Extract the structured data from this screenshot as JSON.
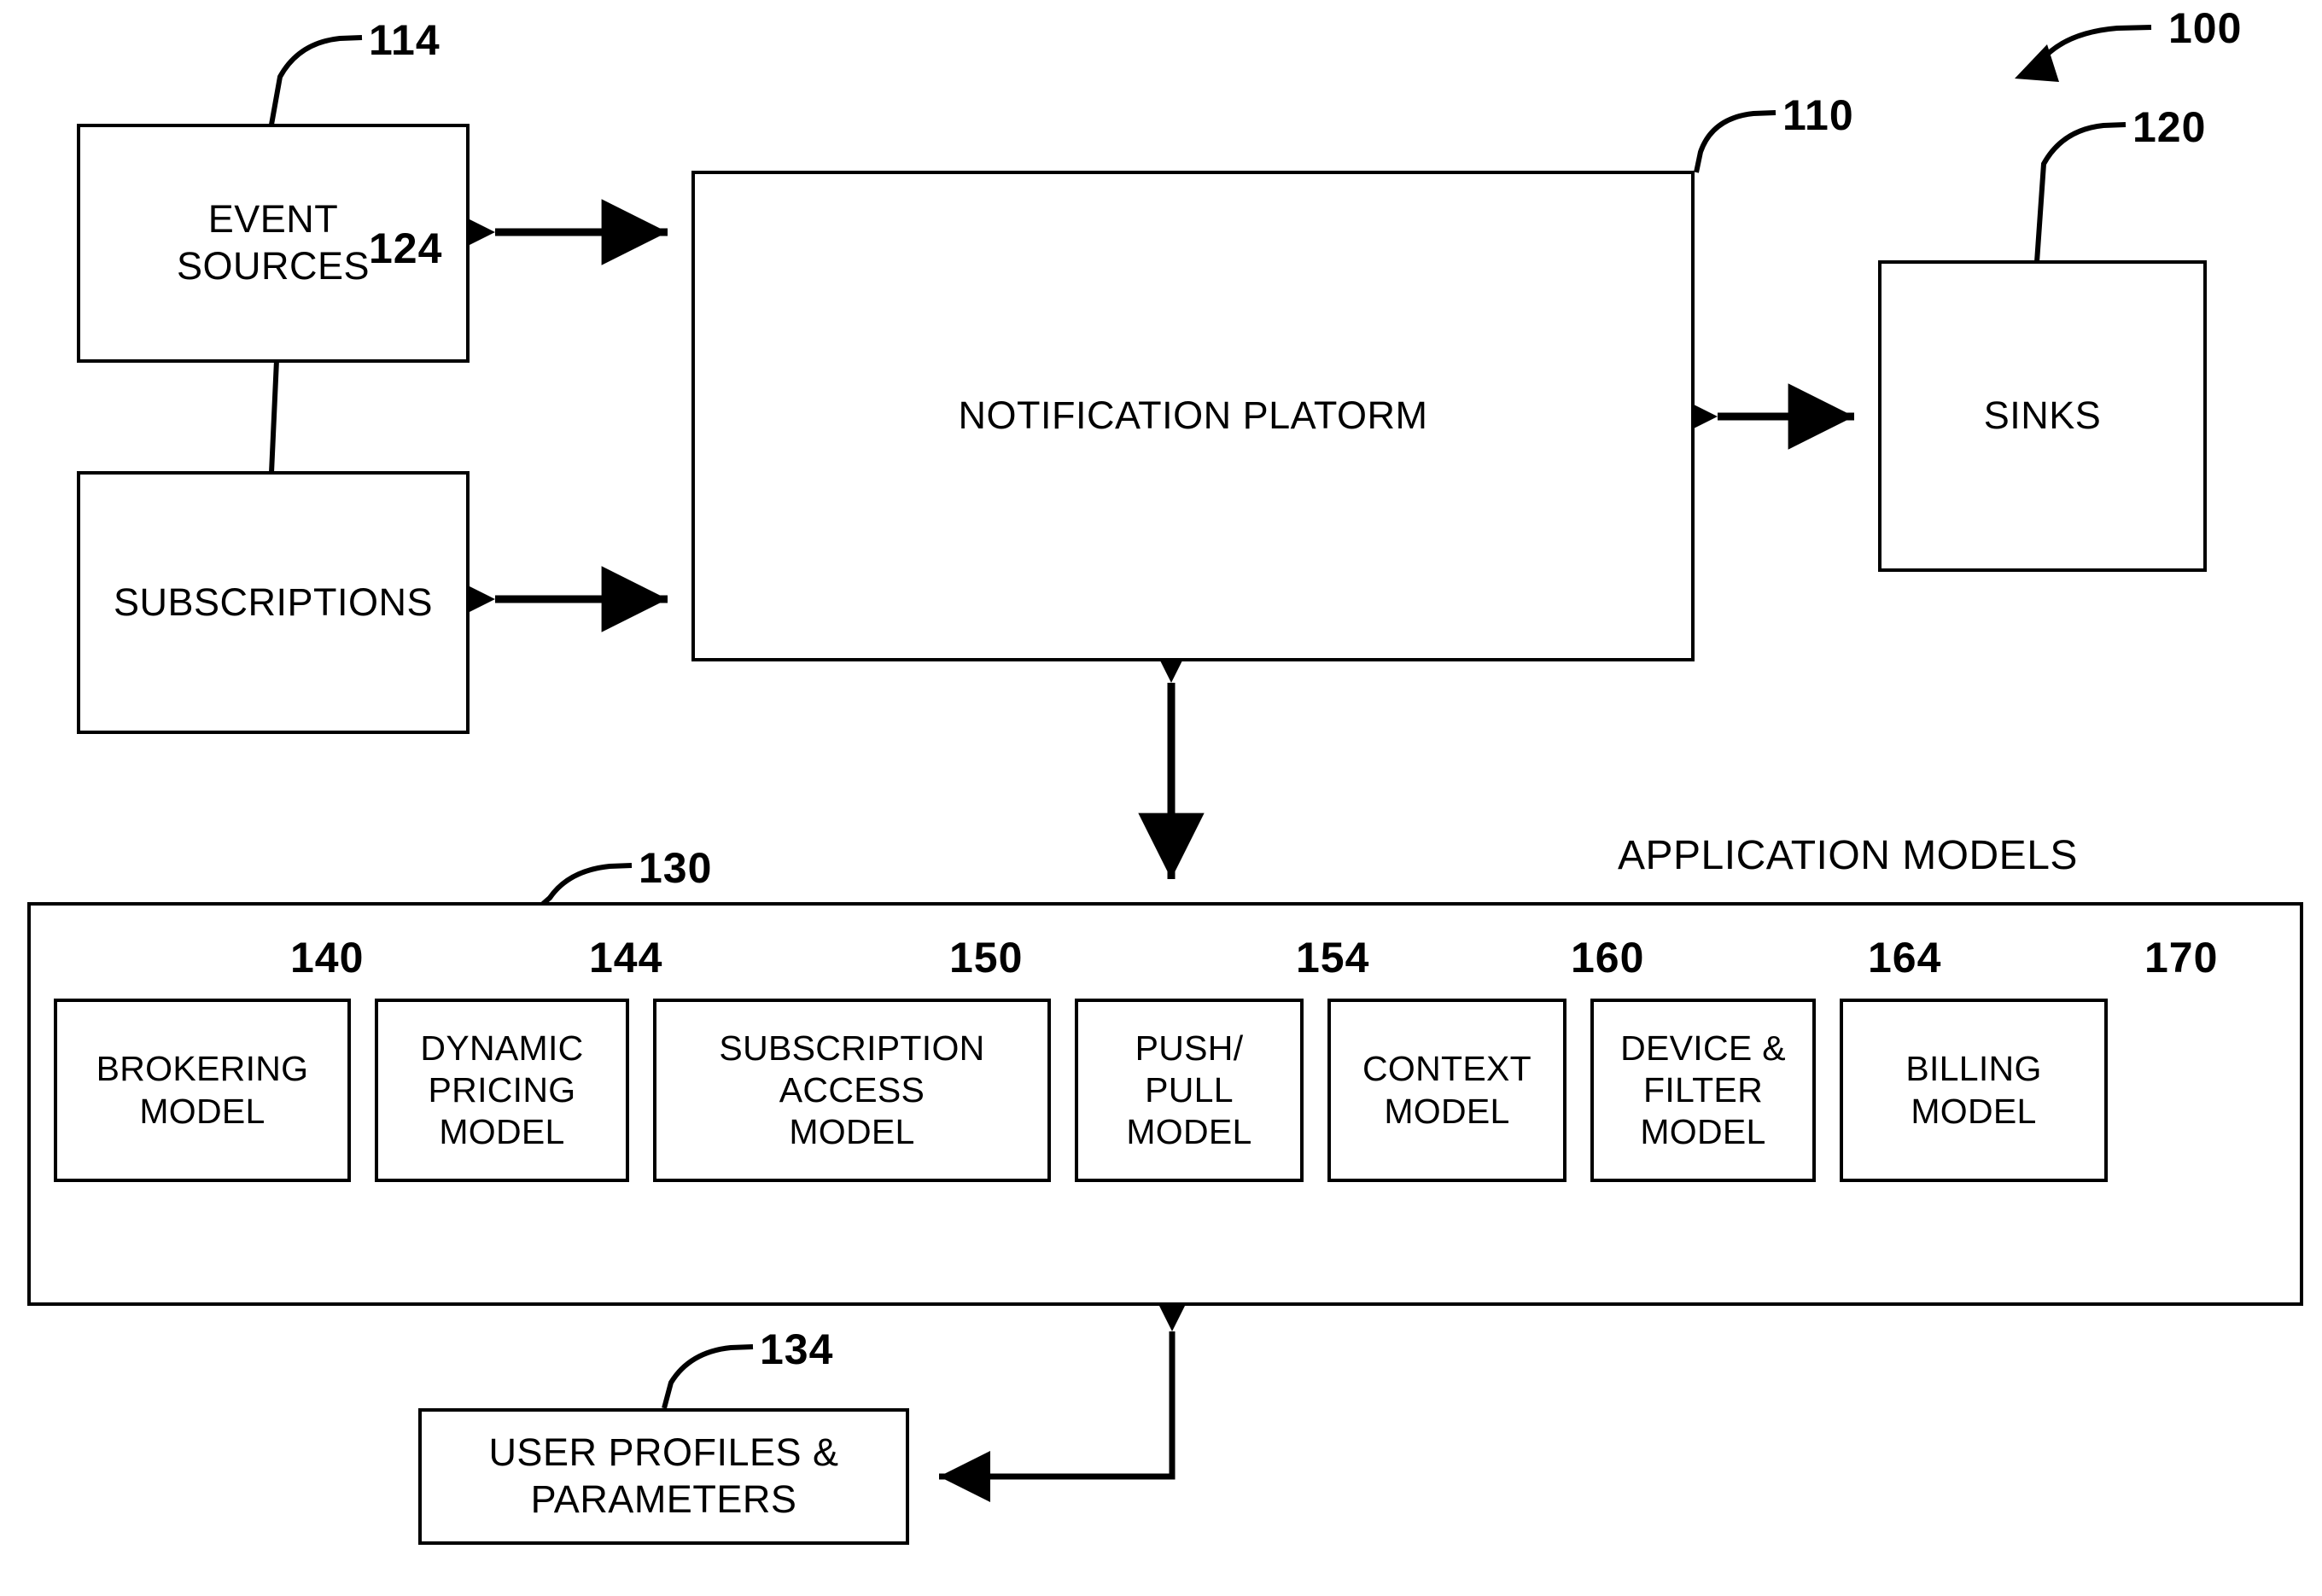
{
  "figure": {
    "reference_numeral": "100",
    "application_models_caption": "APPLICATION MODELS"
  },
  "blocks": {
    "event_sources": {
      "label": "EVENT\nSOURCES",
      "ref": "114"
    },
    "subscriptions": {
      "label": "SUBSCRIPTIONS",
      "ref": "124"
    },
    "platform": {
      "label": "NOTIFICATION PLATORM",
      "ref": "110"
    },
    "sinks": {
      "label": "SINKS",
      "ref": "120"
    },
    "app_models": {
      "label": "APPLICATION MODELS",
      "ref": "130"
    },
    "user_profiles": {
      "label": "USER PROFILES &\nPARAMETERS",
      "ref": "134"
    }
  },
  "models": [
    {
      "label": "BROKERING\nMODEL",
      "ref": "140"
    },
    {
      "label": "DYNAMIC\nPRICING\nMODEL",
      "ref": "144"
    },
    {
      "label": "SUBSCRIPTION\nACCESS\nMODEL",
      "ref": "150"
    },
    {
      "label": "PUSH/\nPULL\nMODEL",
      "ref": "154"
    },
    {
      "label": "CONTEXT\nMODEL",
      "ref": "160"
    },
    {
      "label": "DEVICE &\nFILTER\nMODEL",
      "ref": "164"
    },
    {
      "label": "BILLING\nMODEL",
      "ref": "170"
    }
  ],
  "connectors": [
    {
      "name": "event-sources-to-platform",
      "style": "double-arrow",
      "orientation": "horizontal"
    },
    {
      "name": "subscriptions-to-platform",
      "style": "double-arrow",
      "orientation": "horizontal"
    },
    {
      "name": "platform-to-sinks",
      "style": "double-arrow",
      "orientation": "horizontal"
    },
    {
      "name": "platform-to-app-models",
      "style": "double-arrow",
      "orientation": "vertical"
    },
    {
      "name": "user-profiles-to-app-models",
      "style": "single-arrow-elbow",
      "orientation": "l-shaped"
    }
  ],
  "colors": {
    "stroke": "#000000",
    "background": "#ffffff"
  }
}
